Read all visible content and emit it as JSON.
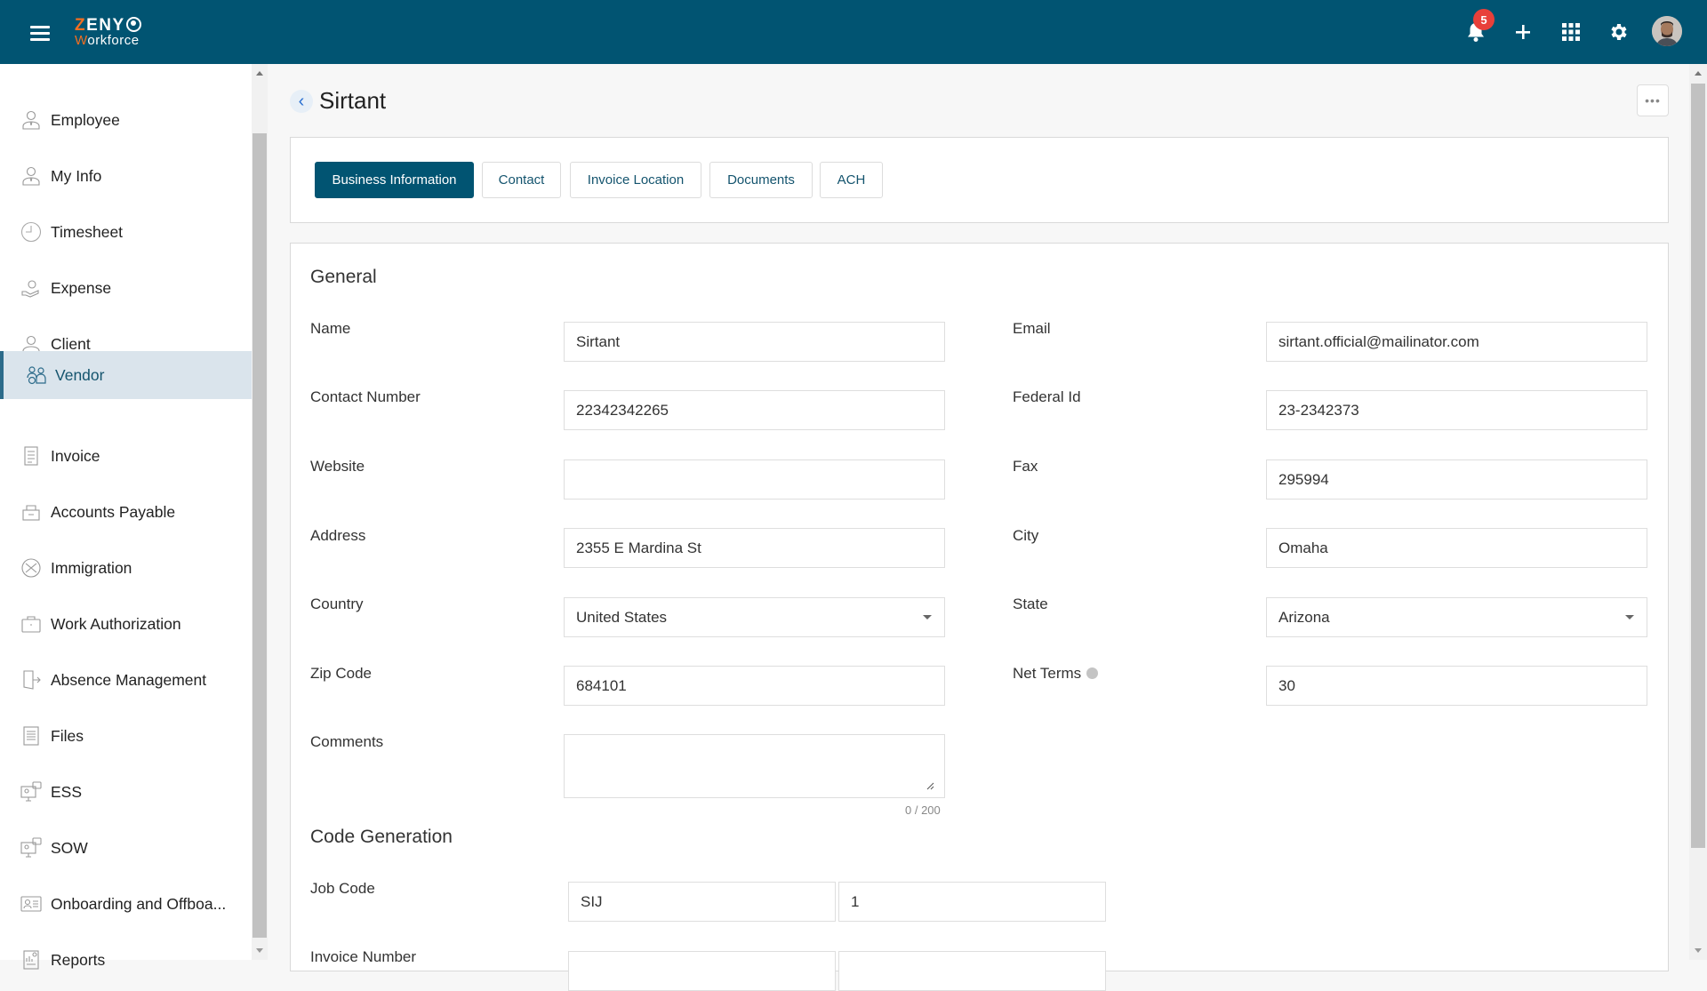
{
  "header": {
    "logo_top_first": "Z",
    "logo_top_rest": "ENY",
    "logo_bottom_first": "W",
    "logo_bottom_rest": "orkforce",
    "notification_count": "5",
    "brand_color": "#015472",
    "accent_color": "#f26f21"
  },
  "sidebar": {
    "items": [
      {
        "label": "Employee",
        "icon": "employee-icon"
      },
      {
        "label": "My Info",
        "icon": "my-info-icon"
      },
      {
        "label": "Timesheet",
        "icon": "clock-icon"
      },
      {
        "label": "Expense",
        "icon": "expense-icon"
      },
      {
        "label": "Client",
        "icon": "client-icon"
      },
      {
        "label": "Vendor",
        "icon": "vendor-icon",
        "active": true
      },
      {
        "label": "Invoice",
        "icon": "invoice-icon"
      },
      {
        "label": "Accounts Payable",
        "icon": "accounts-payable-icon"
      },
      {
        "label": "Immigration",
        "icon": "immigration-icon"
      },
      {
        "label": "Work Authorization",
        "icon": "work-authorization-icon"
      },
      {
        "label": "Absence Management",
        "icon": "absence-icon"
      },
      {
        "label": "Files",
        "icon": "files-icon"
      },
      {
        "label": "ESS",
        "icon": "ess-icon"
      },
      {
        "label": "SOW",
        "icon": "sow-icon"
      },
      {
        "label": "Onboarding and Offboa...",
        "icon": "onboarding-icon"
      },
      {
        "label": "Reports",
        "icon": "reports-icon"
      }
    ]
  },
  "page": {
    "title": "Sirtant",
    "more_label": "•••",
    "back_label": "‹"
  },
  "tabs": [
    {
      "label": "Business Information",
      "active": true
    },
    {
      "label": "Contact"
    },
    {
      "label": "Invoice Location"
    },
    {
      "label": "Documents"
    },
    {
      "label": "ACH"
    }
  ],
  "general": {
    "heading": "General",
    "name": {
      "label": "Name",
      "value": "Sirtant"
    },
    "email": {
      "label": "Email",
      "value": "sirtant.official@mailinator.com"
    },
    "contact_number": {
      "label": "Contact Number",
      "value": "22342342265"
    },
    "federal_id": {
      "label": "Federal Id",
      "value": "23-2342373"
    },
    "website": {
      "label": "Website",
      "value": ""
    },
    "fax": {
      "label": "Fax",
      "value": "295994"
    },
    "address": {
      "label": "Address",
      "value": "2355 E Mardina St"
    },
    "city": {
      "label": "City",
      "value": "Omaha"
    },
    "country": {
      "label": "Country",
      "value": "United States"
    },
    "state": {
      "label": "State",
      "value": "Arizona"
    },
    "zip_code": {
      "label": "Zip Code",
      "value": "684101"
    },
    "net_terms": {
      "label": "Net Terms",
      "value": "30"
    },
    "comments": {
      "label": "Comments",
      "value": "",
      "counter": "0 / 200"
    }
  },
  "code_generation": {
    "heading": "Code Generation",
    "job_code": {
      "label": "Job Code",
      "prefix": "SIJ",
      "number": "1"
    },
    "invoice_number": {
      "label": "Invoice Number"
    }
  }
}
